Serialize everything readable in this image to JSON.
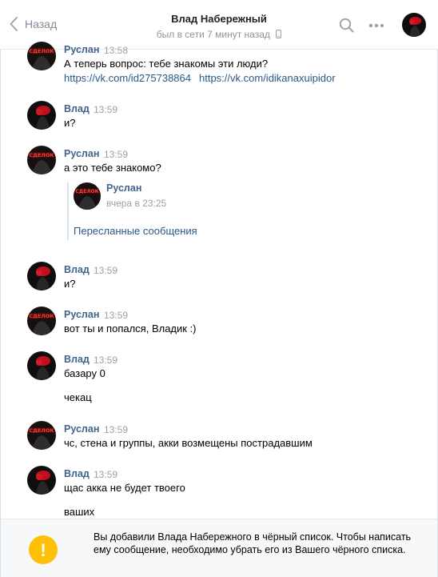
{
  "header": {
    "back_label": "Назад",
    "contact_name": "Влад Набережный",
    "status": "был в сети 7 минут назад"
  },
  "messages": [
    {
      "author": "Руслан",
      "time": "13:58",
      "avatar": "ruslan",
      "lines": [
        "А теперь вопрос: тебе знакомы эти люди?"
      ],
      "links": [
        "https://vk.com/id275738864",
        "https://vk.com/idikanaxuipidor"
      ]
    },
    {
      "author": "Влад",
      "time": "13:59",
      "avatar": "vlad",
      "lines": [
        "и?"
      ]
    },
    {
      "author": "Руслан",
      "time": "13:59",
      "avatar": "ruslan",
      "lines": [
        "а это тебе знакомо?"
      ],
      "forwarded": {
        "author": "Руслан",
        "date": "вчера в 23:25",
        "label": "Пересланные сообщения"
      }
    },
    {
      "author": "Влад",
      "time": "13:59",
      "avatar": "vlad",
      "lines": [
        "и?"
      ]
    },
    {
      "author": "Руслан",
      "time": "13:59",
      "avatar": "ruslan",
      "lines": [
        "вот ты и попался, Владик :)"
      ]
    },
    {
      "author": "Влад",
      "time": "13:59",
      "avatar": "vlad",
      "lines": [
        "базару 0",
        "чекац"
      ]
    },
    {
      "author": "Руслан",
      "time": "13:59",
      "avatar": "ruslan",
      "lines": [
        "чс, стена и группы, акки возмещены пострадавшим"
      ]
    },
    {
      "author": "Влад",
      "time": "13:59",
      "avatar": "vlad",
      "lines": [
        "щас акка не будет твоего",
        "ваших"
      ]
    }
  ],
  "avatar_caption": "СДЕЛОК",
  "blacklist_notice": {
    "text": "Вы добавили Влада Набережного в чёрный список. Чтобы написать ему сообщение, необходимо убрать его из Вашего чёрного списка.",
    "icon": "exclamation-icon"
  },
  "colors": {
    "author": "#42648b",
    "link": "#2a5885",
    "warning": "#ffc107",
    "muted": "#a0a0a0"
  }
}
